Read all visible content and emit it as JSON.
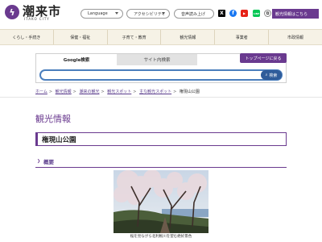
{
  "header": {
    "logo_title": "潮来市",
    "logo_sub": "ITAKO CITY",
    "language_label": "Language",
    "accessibility_label": "アクセシビリティ",
    "voice_label": "音声読み上げ",
    "tourist_button": "観光情報はこちら"
  },
  "nav": {
    "items": [
      "くらし・手続き",
      "保健・福祉",
      "子育て・教育",
      "観光情報",
      "事業者",
      "市政情報"
    ]
  },
  "search": {
    "tab_google": "Google検索",
    "tab_site": "サイト内検索",
    "back_to_top": "トップページに戻る",
    "button_label": "検索",
    "placeholder": ""
  },
  "breadcrumb": {
    "items": [
      "ホーム",
      "観光情報",
      "潮来の観光",
      "観光スポット",
      "主な観光スポット"
    ],
    "current": "権現山公園"
  },
  "content": {
    "page_heading": "観光情報",
    "title": "権現山公園",
    "section_title": "概要",
    "photo_caption": "桜を見ながら北利根川を望む絶好景色"
  },
  "colors": {
    "accent": "#6a3a8f",
    "search_blue": "#2f5c9a",
    "nav_bg": "#f6f2e6"
  }
}
